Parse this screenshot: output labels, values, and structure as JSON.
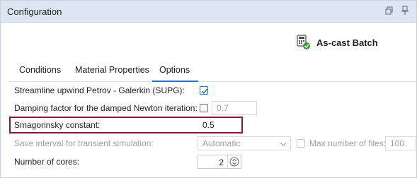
{
  "window": {
    "title": "Configuration"
  },
  "entity": {
    "name": "As-cast Batch"
  },
  "tabs": [
    {
      "label": "Conditions",
      "active": false
    },
    {
      "label": "Material Properties",
      "active": false
    },
    {
      "label": "Options",
      "active": true
    }
  ],
  "options": {
    "supg": {
      "label": "Streamline upwind Petrov - Galerkin (SUPG):",
      "checked": true
    },
    "damping": {
      "label": "Damping factor for the damped Newton iteration:",
      "checked": false,
      "value": "0.7"
    },
    "smagorinsky": {
      "label": "Smagorinsky constant:",
      "value": "0.5"
    },
    "save_interval": {
      "label": "Save interval for transient simulation:",
      "value": "Automatic"
    },
    "max_files": {
      "label": "Max number of files:",
      "checked": false,
      "value": "100"
    },
    "cores": {
      "label": "Number of cores:",
      "value": "2"
    }
  },
  "colors": {
    "titlebar": "#dbe6f2",
    "accent": "#2b73c5",
    "highlight_box": "#8b1a3a"
  }
}
